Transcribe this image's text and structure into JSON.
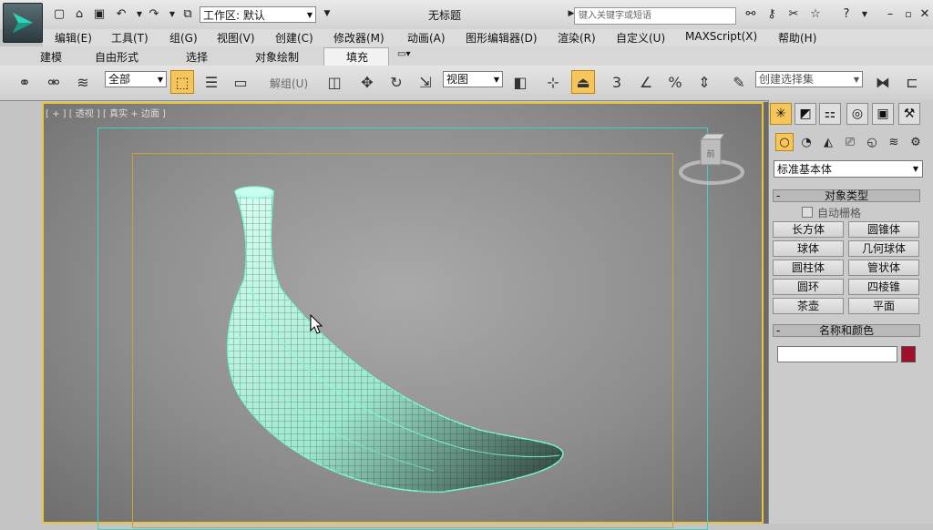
{
  "app": {
    "title": "无标题",
    "workspace_label": "工作区: 默认",
    "search_placeholder": "键入关键字或短语"
  },
  "menus": [
    "编辑(E)",
    "工具(T)",
    "组(G)",
    "视图(V)",
    "创建(C)",
    "修改器(M)",
    "动画(A)",
    "图形编辑器(D)",
    "渲染(R)",
    "自定义(U)",
    "MAXScript(X)",
    "帮助(H)"
  ],
  "ribbon_tabs": [
    "建模",
    "自由形式",
    "选择",
    "对象绘制",
    "填充"
  ],
  "ribbon_active_tab": "填充",
  "toolbar": {
    "filter_value": "全部",
    "unlink_label": "解组(U)",
    "ref_coord_value": "视图",
    "named_selection_placeholder": "创建选择集",
    "snap_label": "3",
    "percent_label": "%"
  },
  "viewport": {
    "label": "[ + ] [ 透视 ] [ 真实 + 边面 ]",
    "viewcube_label": "前"
  },
  "command_panel": {
    "object_type_dropdown": "标准基本体",
    "rollout_object_type": "对象类型",
    "autogrid_label": "自动栅格",
    "buttons": [
      "长方体",
      "圆锥体",
      "球体",
      "几何球体",
      "圆柱体",
      "管状体",
      "圆环",
      "四棱锥",
      "茶壶",
      "平面"
    ],
    "rollout_name_color": "名称和颜色",
    "object_color": "#a0102a"
  },
  "colors": {
    "selection_highlight": "#f7c65a",
    "wireframe": "#7dffd9",
    "viewport_border": "#e8c53a"
  }
}
